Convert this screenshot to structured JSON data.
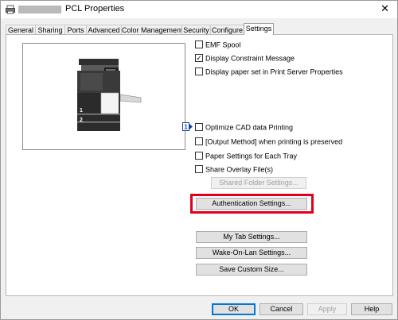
{
  "window": {
    "title": "PCL Properties"
  },
  "tabs": [
    {
      "label": "General"
    },
    {
      "label": "Sharing"
    },
    {
      "label": "Ports"
    },
    {
      "label": "Advanced"
    },
    {
      "label": "Color Management"
    },
    {
      "label": "Security"
    },
    {
      "label": "Configure"
    },
    {
      "label": "Settings",
      "active": true
    }
  ],
  "printer_preview": {
    "tray_labels": [
      "1",
      "2"
    ]
  },
  "options": [
    {
      "label": "EMF Spool",
      "checked": false
    },
    {
      "label": "Display Constraint Message",
      "checked": true
    },
    {
      "label": "Display paper set in Print Server Properties",
      "checked": false
    },
    {
      "label": "Optimize CAD data Printing",
      "checked": false
    },
    {
      "label": "[Output Method] when printing is preserved",
      "checked": false
    },
    {
      "label": "Paper Settings for Each Tray",
      "checked": false
    },
    {
      "label": "Share Overlay File(s)",
      "checked": false
    }
  ],
  "info_icon": {
    "number": "1",
    "icon": "info-pointer-icon"
  },
  "buttons": {
    "shared_folder": "Shared Folder Settings...",
    "authentication": "Authentication Settings...",
    "my_tab": "My Tab Settings...",
    "wake_on_lan": "Wake-On-Lan Settings...",
    "save_custom": "Save Custom Size..."
  },
  "footer": {
    "ok": "OK",
    "cancel": "Cancel",
    "apply": "Apply",
    "help": "Help"
  },
  "colors": {
    "highlight": "#e0001b",
    "accent": "#0078d7"
  }
}
